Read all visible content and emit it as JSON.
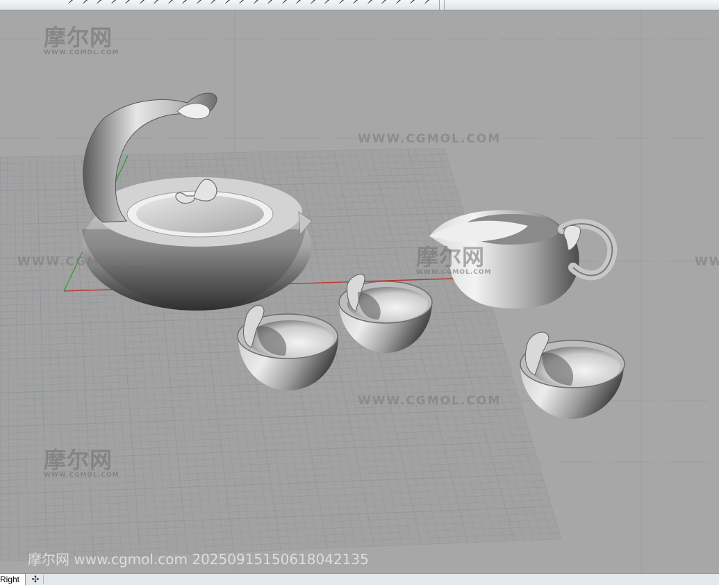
{
  "toolbar": {
    "button_count": 26
  },
  "viewport": {
    "name": "Right",
    "background_color": "#a7a7a7",
    "grid_color": "#8f969c",
    "x_axis_color": "#c0302a",
    "y_axis_color": "#2aa02a",
    "objects": [
      "teapot",
      "pitcher",
      "cup",
      "cup",
      "cup"
    ]
  },
  "watermarks": {
    "url_text": "WWW.CGMOL.COM",
    "logo_text": "摩尔网",
    "logo_small_text": "WWW.CGMOL.COM",
    "stamp": "摩尔网 www.cgmol.com 20250915150618042135"
  },
  "statusbar": {
    "tab_label": "Right",
    "add_tab_icon": "plus-icon",
    "add_tab_glyph": "✣"
  }
}
